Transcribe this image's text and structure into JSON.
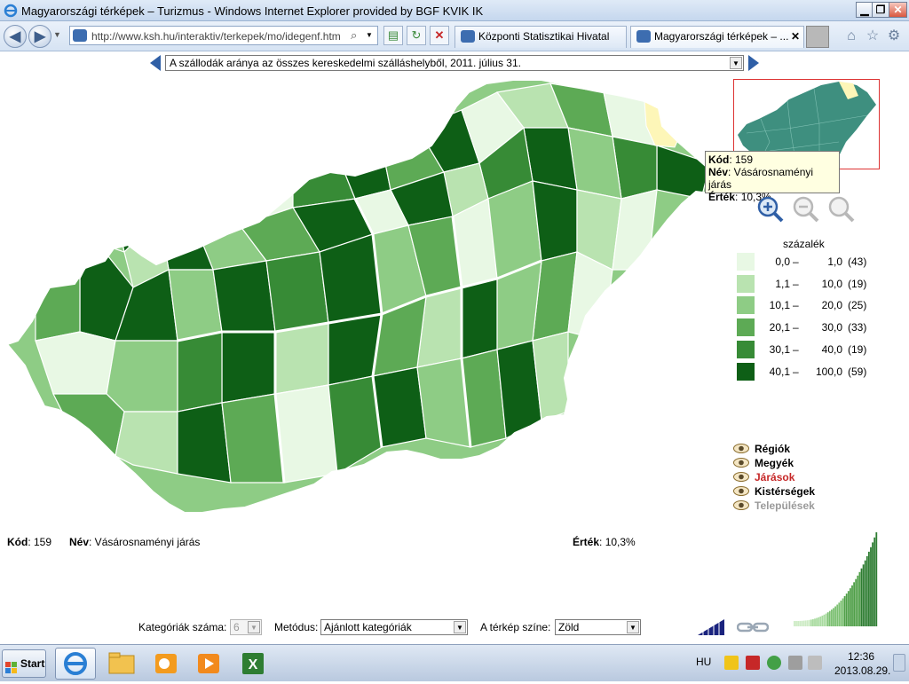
{
  "window": {
    "title": "Magyarországi térképek – Turizmus - Windows Internet Explorer provided by BGF KVIK IK",
    "min_glyph": "▁",
    "max_glyph": "❐",
    "close_glyph": "✕"
  },
  "browser": {
    "url": "http://www.ksh.hu/interaktiv/terkepek/mo/idegenf.htm",
    "tabs": [
      {
        "label": "Központi Statisztikai Hivatal"
      },
      {
        "label": "Magyarországi térképek – ..."
      }
    ],
    "close_tab_glyph": "✕"
  },
  "map_selector": {
    "value": "A szállodák aránya az összes kereskedelmi szálláshelyből, 2011. július 31."
  },
  "tooltip": {
    "kod_label": "Kód",
    "kod_value": ": 159",
    "nev_label": "Név",
    "nev_value": ": Vásárosnaményi járás",
    "ertek_label": "Érték",
    "ertek_value": ": 10,3%"
  },
  "legend": {
    "title": "százalék",
    "rows": [
      {
        "lo": "0,0",
        "hi": "1,0",
        "count": "(43)",
        "color": "#e8f8e4"
      },
      {
        "lo": "1,1",
        "hi": "10,0",
        "count": "(19)",
        "color": "#b9e3b0"
      },
      {
        "lo": "10,1",
        "hi": "20,0",
        "count": "(25)",
        "color": "#8ecc85"
      },
      {
        "lo": "20,1",
        "hi": "30,0",
        "count": "(33)",
        "color": "#5daa55"
      },
      {
        "lo": "30,1",
        "hi": "40,0",
        "count": "(19)",
        "color": "#378b36"
      },
      {
        "lo": "40,1",
        "hi": "100,0",
        "count": "(59)",
        "color": "#0e5f16"
      }
    ],
    "dash": "–"
  },
  "layers": [
    {
      "label": "Régiók",
      "color": "#000000"
    },
    {
      "label": "Megyék",
      "color": "#000000"
    },
    {
      "label": "Járások",
      "color": "#c62828"
    },
    {
      "label": "Kistérségek",
      "color": "#000000"
    },
    {
      "label": "Települések",
      "color": "#9a9a9a"
    }
  ],
  "info": {
    "kod_label": "Kód",
    "kod_value": ": 159",
    "nev_label": "Név",
    "nev_value": ": Vásárosnaményi járás",
    "ertek_label": "Érték",
    "ertek_value": ": 10,3%"
  },
  "controls": {
    "categories_label": "Kategóriák száma:",
    "categories_value": "6",
    "method_label": "Metódus:",
    "method_value": "Ajánlott kategóriák",
    "color_label": "A térkép színe:",
    "color_value": "Zöld"
  },
  "taskbar": {
    "start_label": "Start",
    "lang": "HU",
    "time": "12:36",
    "date": "2013.08.29."
  }
}
